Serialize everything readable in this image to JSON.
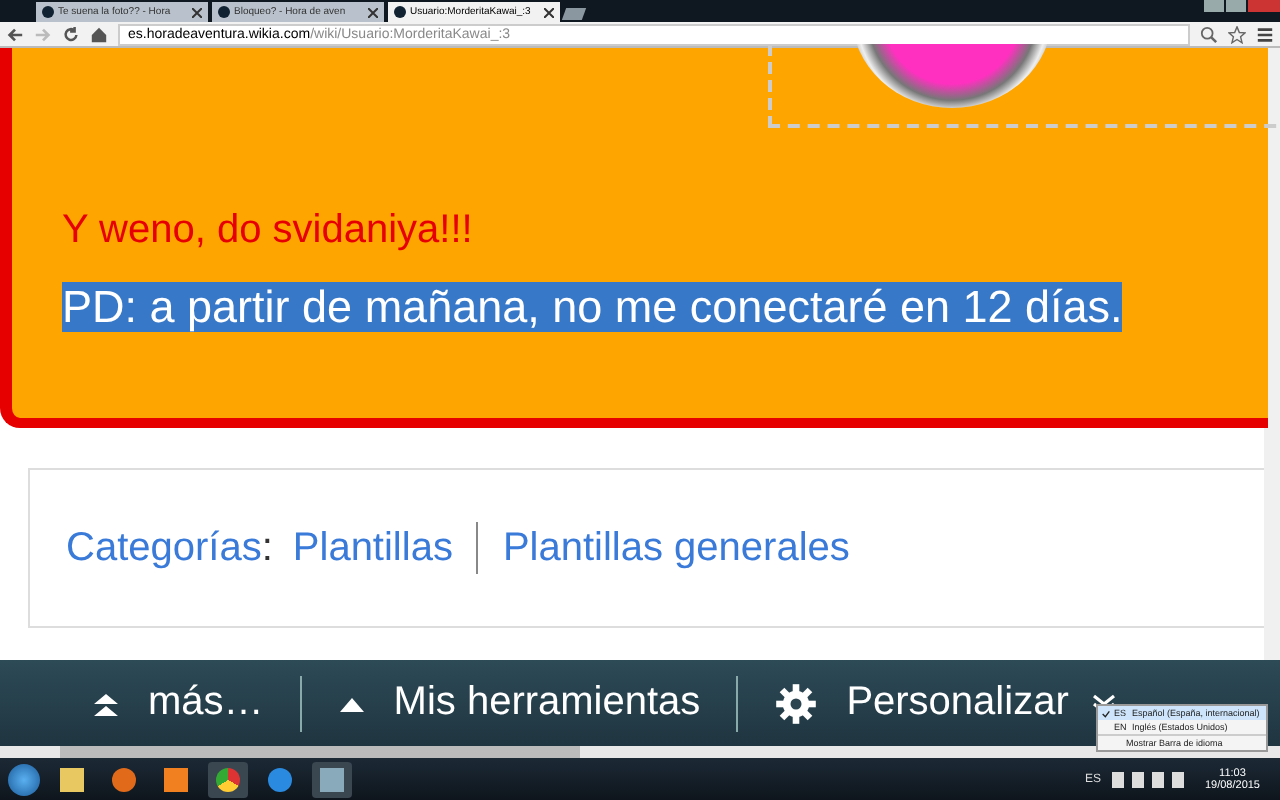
{
  "browser": {
    "tabs": [
      {
        "title": "Te suena la foto?? - Hora",
        "selected": false
      },
      {
        "title": "Bloqueo? - Hora de aven",
        "selected": false
      },
      {
        "title": "Usuario:MorderitaKawai_:3",
        "selected": true
      }
    ],
    "url_host": "es.horadeaventura.wikia.com",
    "url_path": "/wiki/Usuario:MorderitaKawai_:3"
  },
  "content": {
    "farewell": "Y weno, do svidaniya!!!",
    "selected_text": "PD: a partir de mañana, no me conectaré en 12 días.",
    "categories_label": "Categorías",
    "categories_colon": ":",
    "categories": [
      "Plantillas",
      "Plantillas generales"
    ]
  },
  "toolbar": {
    "items": [
      {
        "label": "más…",
        "kind": "double"
      },
      {
        "label": "Mis herramientas",
        "kind": "single"
      },
      {
        "label": "Personalizar",
        "kind": "gear"
      }
    ]
  },
  "language_menu": [
    {
      "code": "ES",
      "label": "Español (España, internacional)",
      "selected": true
    },
    {
      "code": "EN",
      "label": "Inglés (Estados Unidos)",
      "selected": false
    }
  ],
  "language_menu_footer": "Mostrar Barra de idioma",
  "taskbar": {
    "language": "ES",
    "time": "11:03",
    "date": "19/08/2015"
  }
}
